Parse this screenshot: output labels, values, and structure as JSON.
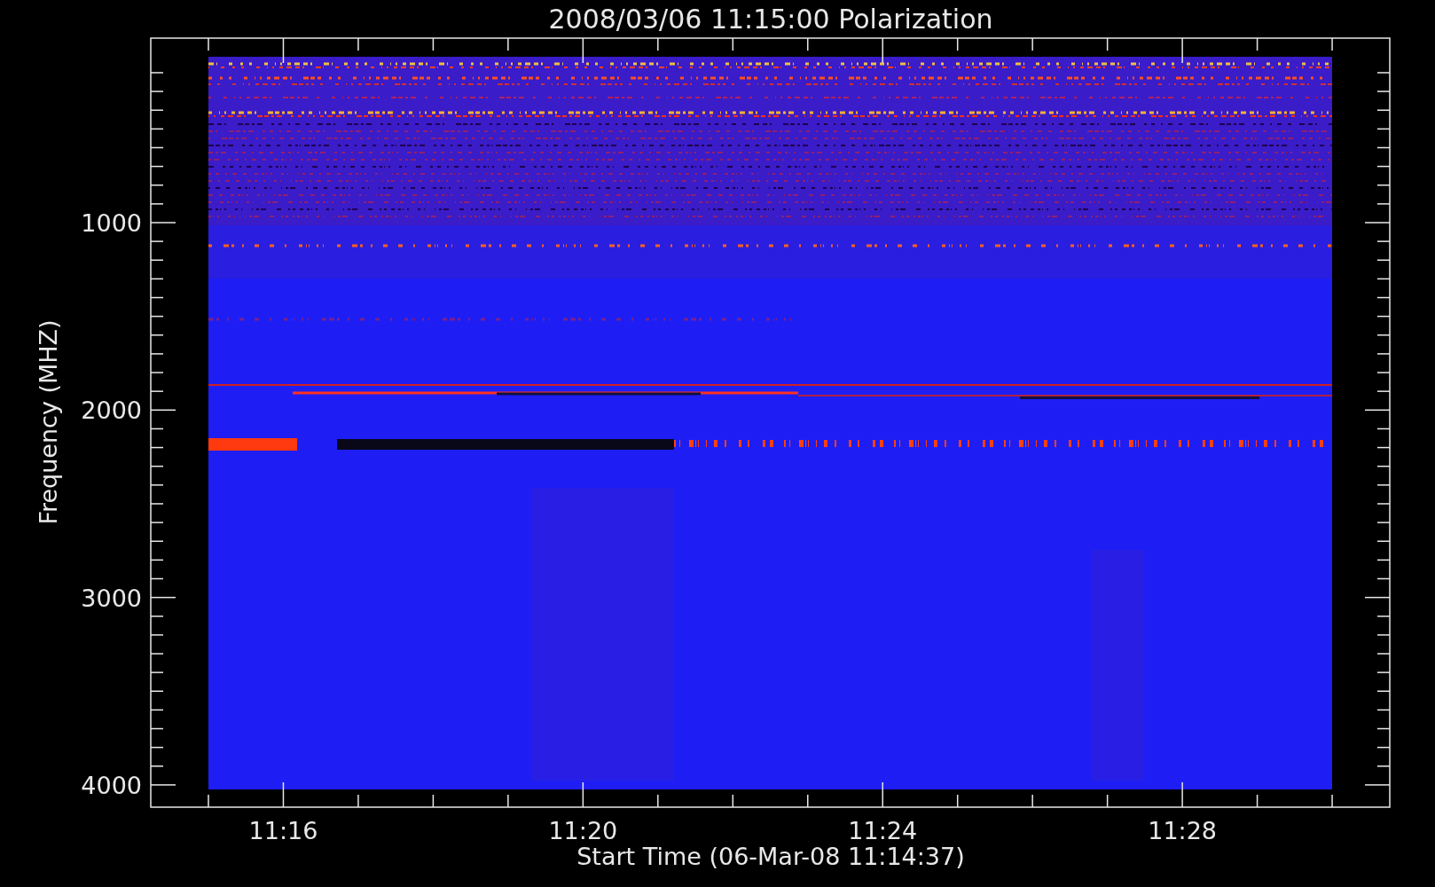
{
  "plot": {
    "title": "2008/03/06 11:15:00 Polarization",
    "ylabel": "Frequency (MHZ)",
    "xlabel": "Start Time (06-Mar-08 11:14:37)",
    "y_tick_labels": [
      "1000",
      "2000",
      "3000",
      "4000"
    ],
    "x_tick_labels": [
      "11:16",
      "11:20",
      "11:24",
      "11:28"
    ]
  }
}
